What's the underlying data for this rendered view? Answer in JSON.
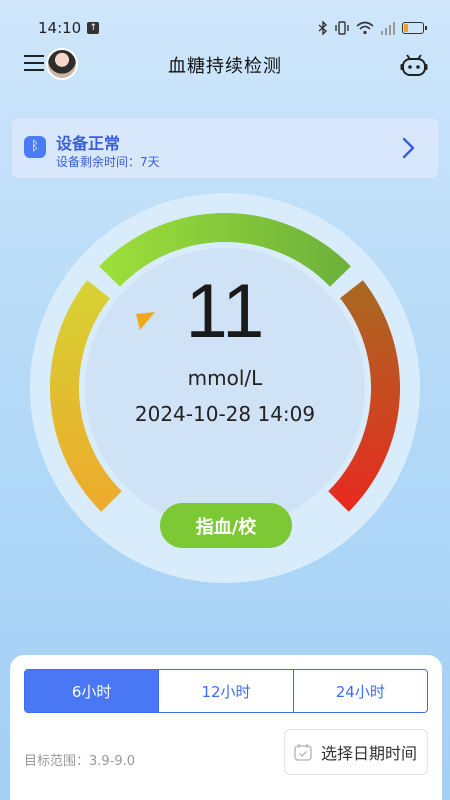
{
  "status_bar": {
    "time": "14:10",
    "battery_level": 0.25,
    "icon_names": [
      "upload-icon",
      "bluetooth-icon",
      "vibrate-icon",
      "wifi-icon",
      "signal-icon",
      "battery-icon"
    ]
  },
  "header": {
    "title": "血糖持续检测"
  },
  "device": {
    "status": "设备正常",
    "remaining": "设备剩余时间：7天"
  },
  "reading": {
    "value": "11",
    "unit": "mmol/L",
    "timestamp": "2024-10-28 14:09"
  },
  "calibrate_label": "指血/校",
  "time_ranges": [
    {
      "label": "6小时",
      "active": true
    },
    {
      "label": "12小时",
      "active": false
    },
    {
      "label": "24小时",
      "active": false
    }
  ],
  "target_range": "目标范围：3.9-9.0",
  "date_picker_label": "选择日期时间",
  "colors": {
    "accent": "#4a77f4",
    "device_text": "#3a5fd8",
    "calibrate": "#7cc835",
    "gauge_low": "#e8b12a",
    "gauge_normal": "#8fd13a",
    "gauge_high": "#e23a22"
  }
}
